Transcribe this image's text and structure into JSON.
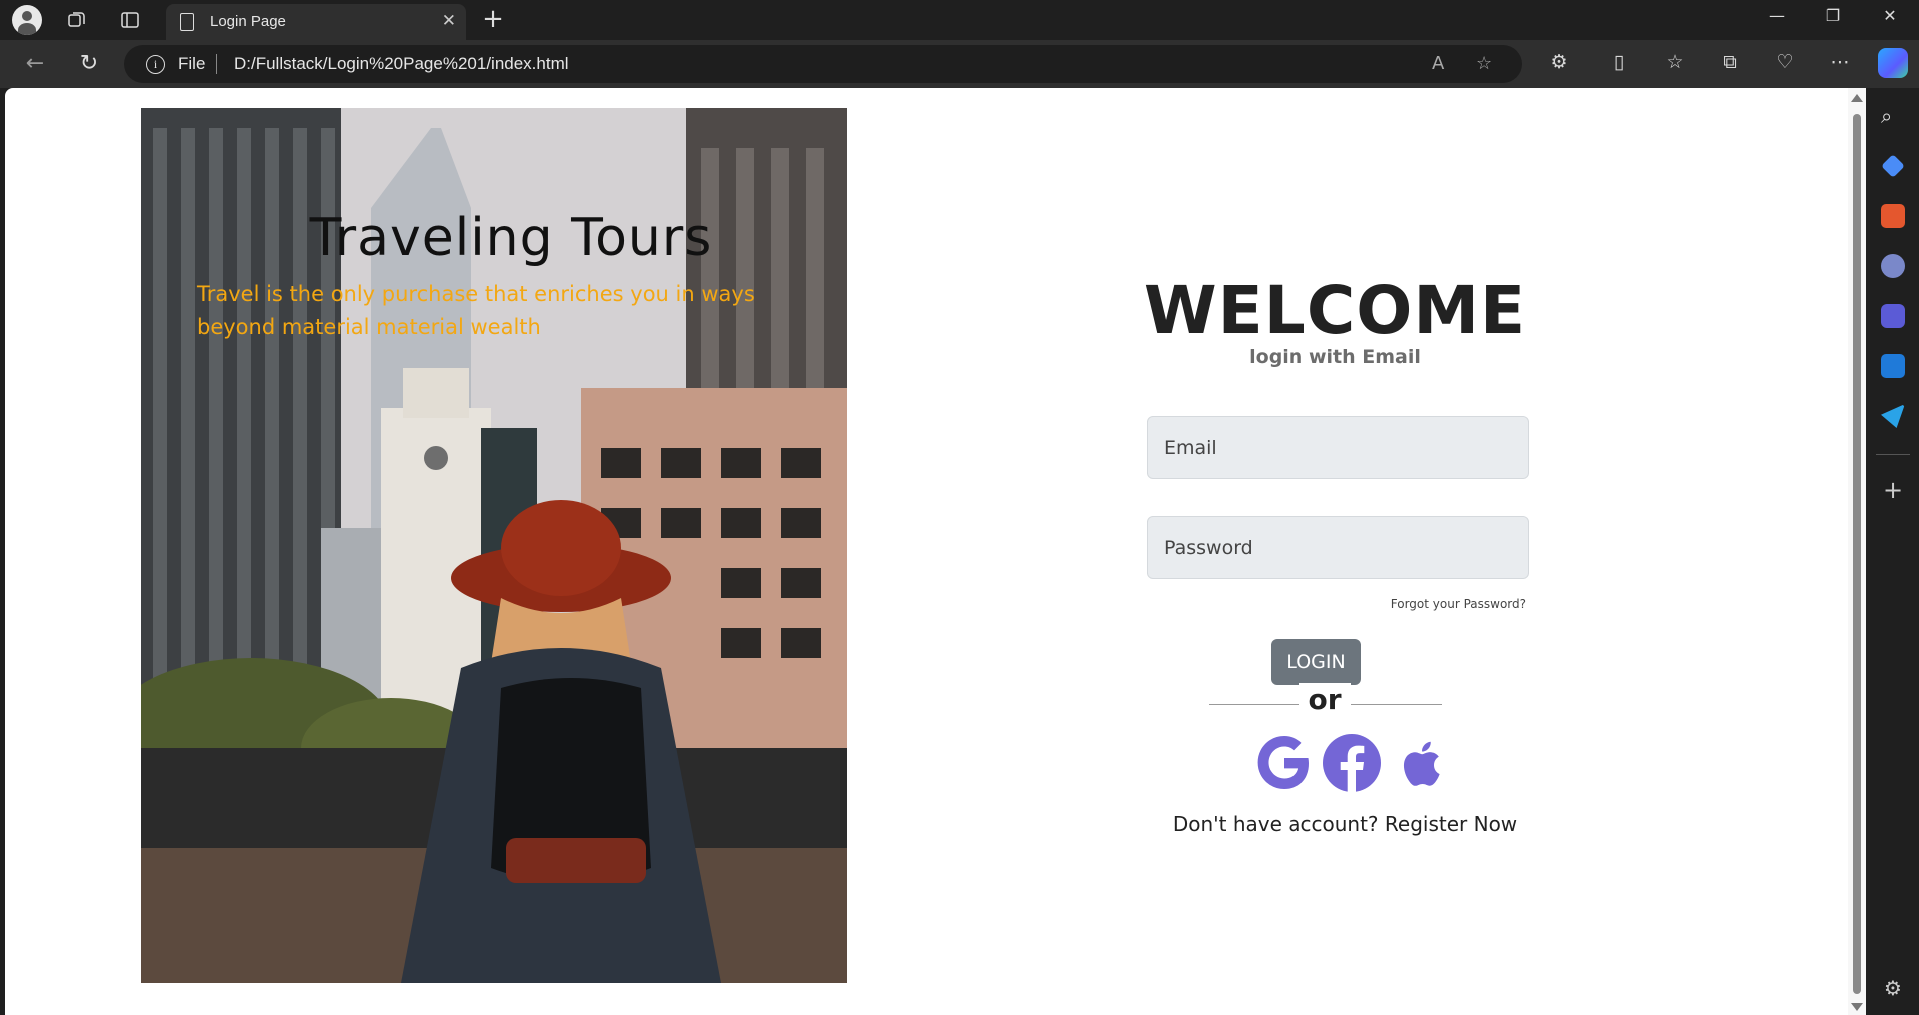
{
  "browser": {
    "tab_title": "Login Page",
    "address_scheme": "File",
    "address_url": "D:/Fullstack/Login%20Page%201/index.html"
  },
  "hero": {
    "title": "Traveling Tours",
    "quote": "Travel is the only purchase that enriches you in ways beyond material material wealth"
  },
  "login": {
    "heading": "WELCOME",
    "subtitle": "login with Email",
    "email_placeholder": "Email",
    "password_placeholder": "Password",
    "forgot_label": "Forgot your Password?",
    "login_label": "LOGIN",
    "or_label": "or",
    "register_prompt": "Don't have account?",
    "register_link": "Register Now",
    "social_icon_color": "#7466d6",
    "social": [
      "google-icon",
      "facebook-icon",
      "apple-icon"
    ]
  },
  "colors": {
    "quote": "#f3a712",
    "login_button": "#6c757d",
    "input_bg": "#e9ecef"
  }
}
